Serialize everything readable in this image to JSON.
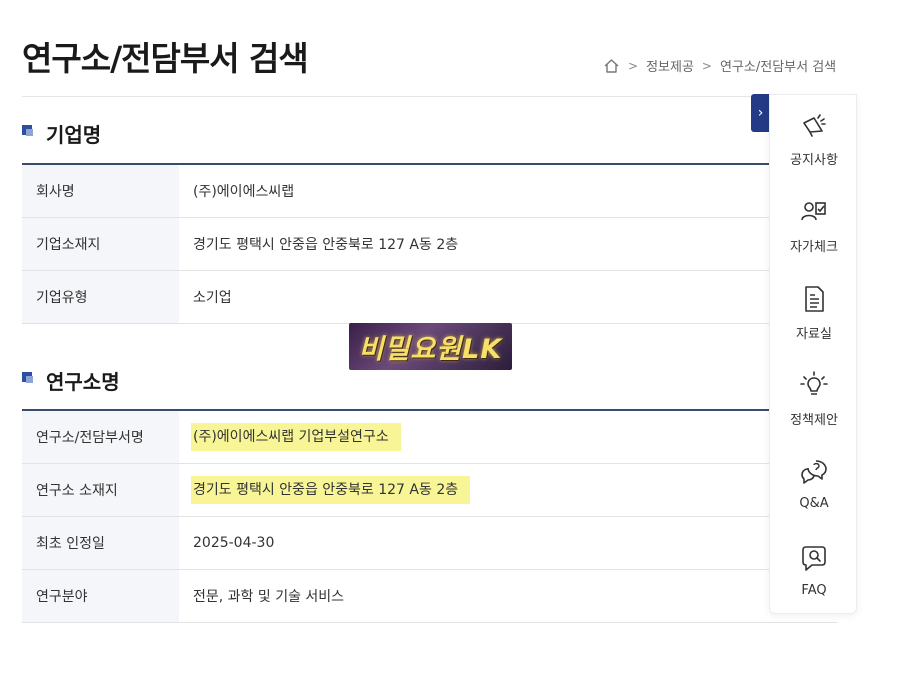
{
  "page": {
    "title": "연구소/전담부서 검색",
    "breadcrumb": [
      "정보제공",
      "연구소/전담부서 검색"
    ]
  },
  "company_section": {
    "heading": "기업명",
    "rows": [
      {
        "label": "회사명",
        "value": "(주)에이에스씨랩"
      },
      {
        "label": "기업소재지",
        "value": "경기도 평택시 안중읍 안중북로 127 A동 2층"
      },
      {
        "label": "기업유형",
        "value": "소기업"
      }
    ]
  },
  "lab_section": {
    "heading": "연구소명",
    "rows": [
      {
        "label": "연구소/전담부서명",
        "value": "(주)에이에스씨랩 기업부설연구소",
        "highlighted": true
      },
      {
        "label": "연구소 소재지",
        "value": "경기도 평택시 안중읍 안중북로 127 A동 2층",
        "highlighted": true
      },
      {
        "label": "최초 인정일",
        "value": "2025-04-30",
        "highlighted": false
      },
      {
        "label": "연구분야",
        "value": "전문, 과학 및 기술 서비스",
        "highlighted": false
      }
    ]
  },
  "watermark": {
    "text": "비밀요원LK"
  },
  "quick_menu": {
    "toggle_icon": "chevron-right-icon",
    "items": [
      {
        "label": "공지사항",
        "icon": "megaphone-icon"
      },
      {
        "label": "자가체크",
        "icon": "user-check-icon"
      },
      {
        "label": "자료실",
        "icon": "document-icon"
      },
      {
        "label": "정책제안",
        "icon": "lightbulb-icon"
      },
      {
        "label": "Q&A",
        "icon": "chat-question-icon"
      },
      {
        "label": "FAQ",
        "icon": "chat-search-icon"
      }
    ]
  },
  "colors": {
    "accent_navy": "#243a86",
    "table_border": "#3a4c6e",
    "highlight": "#f7f596",
    "watermark_text": "#f6e06a"
  }
}
